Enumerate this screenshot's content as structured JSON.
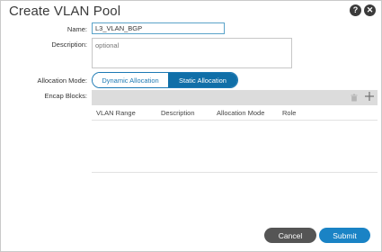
{
  "dialog": {
    "title": "Create VLAN Pool",
    "help_glyph": "?",
    "close_glyph": "✕"
  },
  "form": {
    "name_label": "Name:",
    "name_value": "L3_VLAN_BGP",
    "description_label": "Description:",
    "description_placeholder": "optional",
    "allocation_label": "Allocation Mode:",
    "allocation_options": [
      "Dynamic Allocation",
      "Static Allocation"
    ],
    "allocation_selected": "Static Allocation",
    "encap_label": "Encap Blocks:"
  },
  "encap_table": {
    "toolbar": {
      "delete_icon": "trash-icon",
      "add_icon": "plus-icon"
    },
    "columns": [
      "VLAN Range",
      "Description",
      "Allocation Mode",
      "Role"
    ],
    "rows": []
  },
  "footer": {
    "cancel_label": "Cancel",
    "submit_label": "Submit"
  },
  "colors": {
    "accent": "#106fa8",
    "submit": "#1a83c5",
    "cancel": "#555555",
    "header_icon": "#3b3b3b"
  }
}
